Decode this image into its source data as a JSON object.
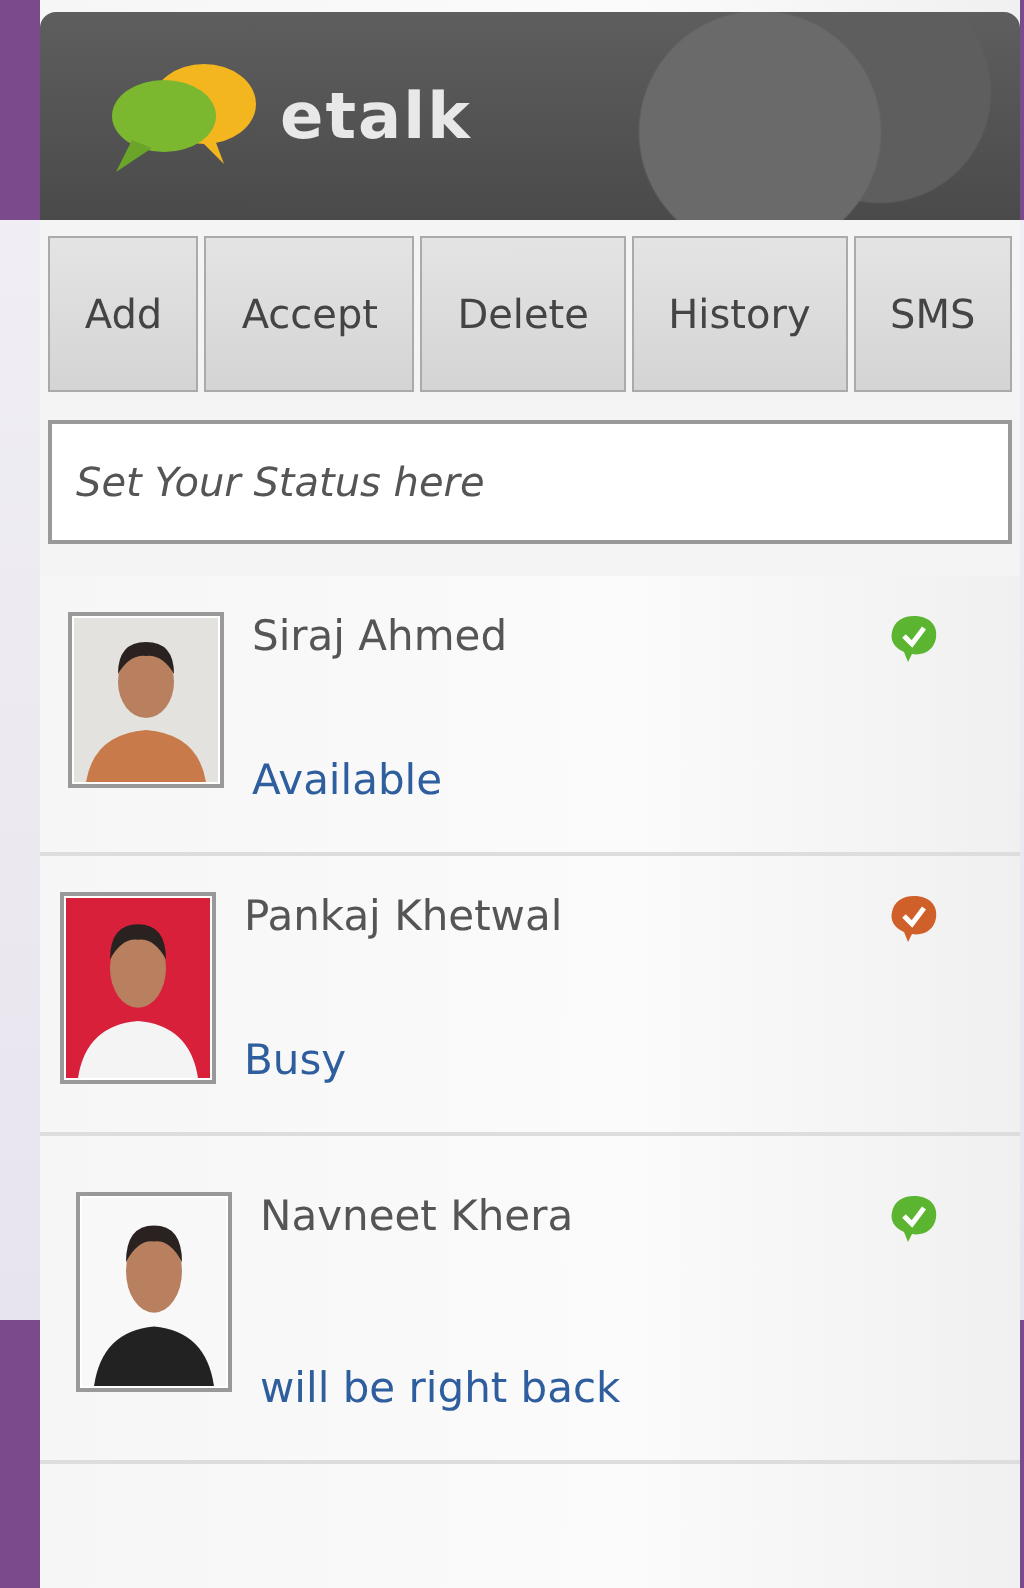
{
  "app": {
    "name": "etalk"
  },
  "toolbar": [
    {
      "label": "Add"
    },
    {
      "label": "Accept"
    },
    {
      "label": "Delete"
    },
    {
      "label": "History"
    },
    {
      "label": "SMS"
    }
  ],
  "status_field": {
    "placeholder": "Set Your Status here"
  },
  "contacts": [
    {
      "name": "Siraj Ahmed",
      "status": "Available",
      "color": "#5cb531"
    },
    {
      "name": "Pankaj Khetwal",
      "status": "Busy",
      "color": "#d0602a"
    },
    {
      "name": "Navneet Khera",
      "status": "will be right back",
      "color": "#5cb531"
    }
  ]
}
